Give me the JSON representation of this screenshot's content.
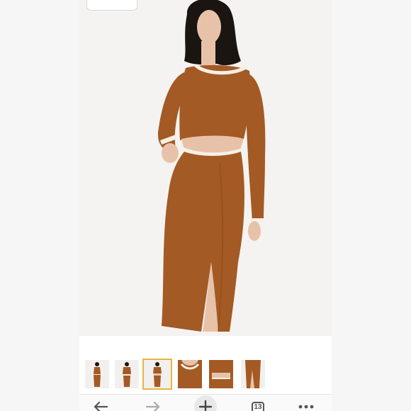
{
  "gallery": {
    "thumbnail_count": 6,
    "selected_index": 2,
    "colors": {
      "dress": "#a45a24",
      "dress_shadow": "#8a4a1d",
      "trim": "#f6efe6",
      "skin": "#e8c2a8",
      "hair": "#1b1512",
      "selection_border": "#e7b641"
    }
  },
  "toolbar": {
    "back_icon": "back-arrow-icon",
    "forward_icon": "forward-arrow-icon",
    "new_tab_icon": "plus-icon",
    "tabs_count": "13",
    "menu_icon": "more-icon"
  }
}
